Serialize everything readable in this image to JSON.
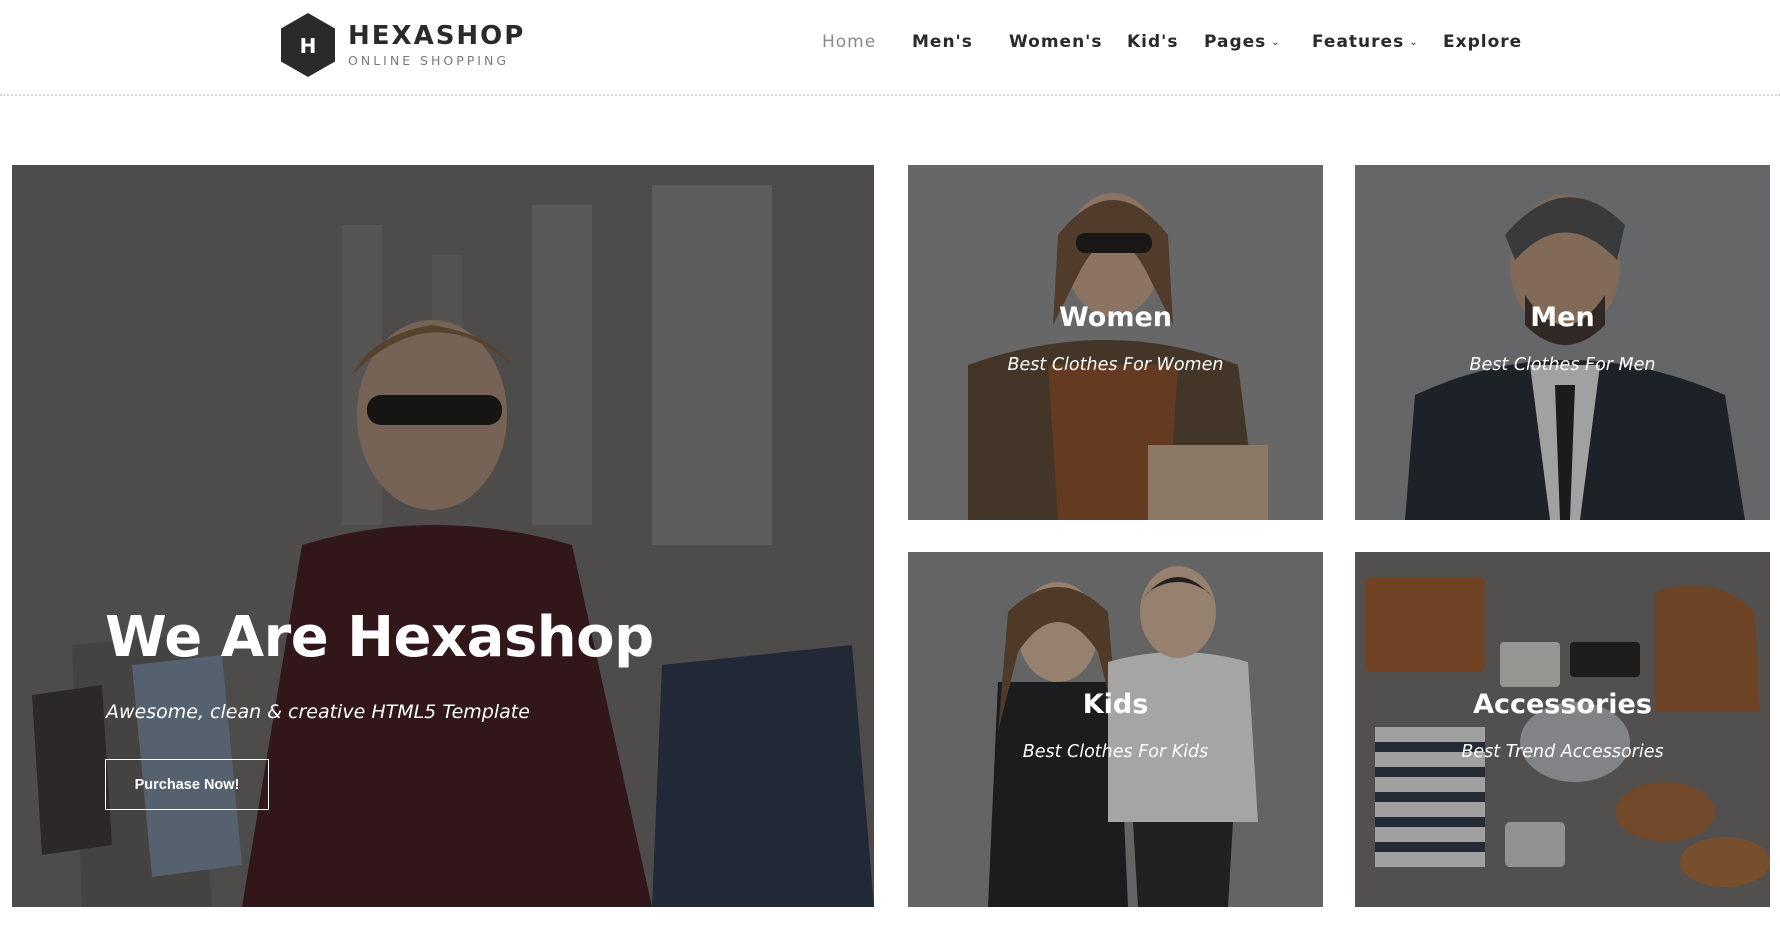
{
  "brand": {
    "title": "HEXASHOP",
    "subtitle": "ONLINE SHOPPING",
    "mark": "H"
  },
  "nav": {
    "items": [
      {
        "label": "Home",
        "active": true
      },
      {
        "label": "Men's"
      },
      {
        "label": "Women's"
      },
      {
        "label": "Kid's"
      },
      {
        "label": "Pages",
        "dropdown": true
      },
      {
        "label": "Features",
        "dropdown": true
      },
      {
        "label": "Explore"
      }
    ]
  },
  "hero": {
    "title": "We Are Hexashop",
    "subtitle": "Awesome, clean & creative HTML5 Template",
    "button": "Purchase Now!"
  },
  "categories": [
    {
      "title": "Women",
      "subtitle": "Best Clothes For Women"
    },
    {
      "title": "Men",
      "subtitle": "Best Clothes For Men"
    },
    {
      "title": "Kids",
      "subtitle": "Best Clothes For Kids"
    },
    {
      "title": "Accessories",
      "subtitle": "Best Trend Accessories"
    }
  ],
  "colors": {
    "text_dark": "#2a2a2a",
    "nav_active": "#8a8a8a",
    "overlay_text": "#ffffff"
  },
  "icons": {
    "logo": "hexagon-logo-icon",
    "dropdown": "chevron-down-icon"
  }
}
